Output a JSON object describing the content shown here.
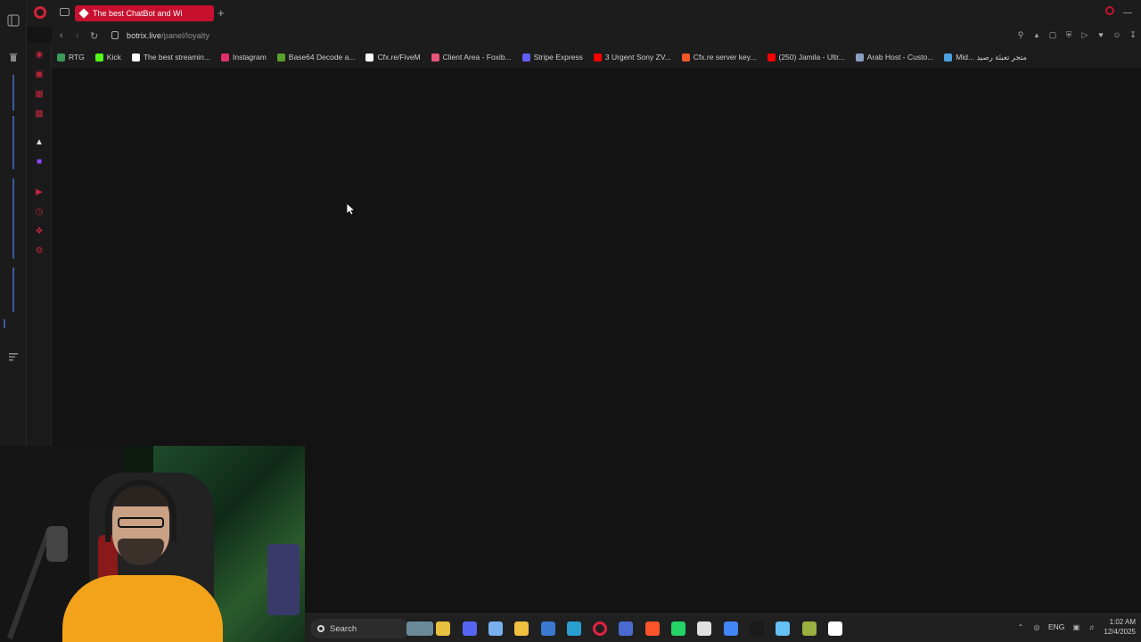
{
  "browser": {
    "tab_title": "The best ChatBot and Wi",
    "url_host": "botrix.live",
    "url_path": "/panel/loyalty"
  },
  "bookmarks": [
    {
      "label": "RTG",
      "icon": "rtg-icon",
      "color": "#3a9a5a"
    },
    {
      "label": "Kick",
      "icon": "kick-icon",
      "color": "#53fc18"
    },
    {
      "label": "The best streamin...",
      "icon": "botrix-icon",
      "color": "#ffffff"
    },
    {
      "label": "Instagram",
      "icon": "instagram-icon",
      "color": "#e1306c"
    },
    {
      "label": "Base64 Decode a...",
      "icon": "base64-icon",
      "color": "#5aa02c"
    },
    {
      "label": "Cfx.re/FiveM",
      "icon": "cfx-icon",
      "color": "#ffffff"
    },
    {
      "label": "Client Area - Foxib...",
      "icon": "foxib-icon",
      "color": "#e8557a"
    },
    {
      "label": "Stripe Express",
      "icon": "stripe-icon",
      "color": "#635bff"
    },
    {
      "label": "3 Urgent Sony ZV...",
      "icon": "youtube-icon",
      "color": "#ff0000"
    },
    {
      "label": "Cfx.re server key...",
      "icon": "cfx-icon",
      "color": "#f05a28"
    },
    {
      "label": "(250) Jamila - Ultr...",
      "icon": "youtube-icon",
      "color": "#ff0000"
    },
    {
      "label": "Arab Host - Custo...",
      "icon": "arabhost-icon",
      "color": "#8aa0c0"
    },
    {
      "label": "Mid... متجر تعبئة رصيد",
      "icon": "store-icon",
      "color": "#4aa0e0"
    }
  ],
  "taskbar": {
    "search_label": "Search",
    "language": "ENG",
    "time": "1:02 AM",
    "date": "12/4/2025",
    "apps": [
      {
        "name": "widgets-icon",
        "color": "#6a8a9a"
      },
      {
        "name": "file-explorer-icon",
        "color": "#e8c040"
      },
      {
        "name": "discord-icon",
        "color": "#5865f2"
      },
      {
        "name": "copilot-icon",
        "color": "#7ab0f0"
      },
      {
        "name": "folder-icon",
        "color": "#f0c040"
      },
      {
        "name": "store-icon",
        "color": "#3a7ad0"
      },
      {
        "name": "edge-icon",
        "color": "#2aa0d0"
      },
      {
        "name": "opera-icon",
        "color": "#e02040"
      },
      {
        "name": "app-icon",
        "color": "#4a6ad0"
      },
      {
        "name": "brave-icon",
        "color": "#fb542b"
      },
      {
        "name": "whatsapp-icon",
        "color": "#25d366"
      },
      {
        "name": "app2-icon",
        "color": "#e0e0e0"
      },
      {
        "name": "chrome-icon",
        "color": "#4285f4"
      },
      {
        "name": "terminal-icon",
        "color": "#1a1a1a"
      },
      {
        "name": "steam-icon",
        "color": "#66c0f4"
      },
      {
        "name": "app3-icon",
        "color": "#9ab040"
      },
      {
        "name": "capcut-icon",
        "color": "#ffffff"
      }
    ]
  }
}
